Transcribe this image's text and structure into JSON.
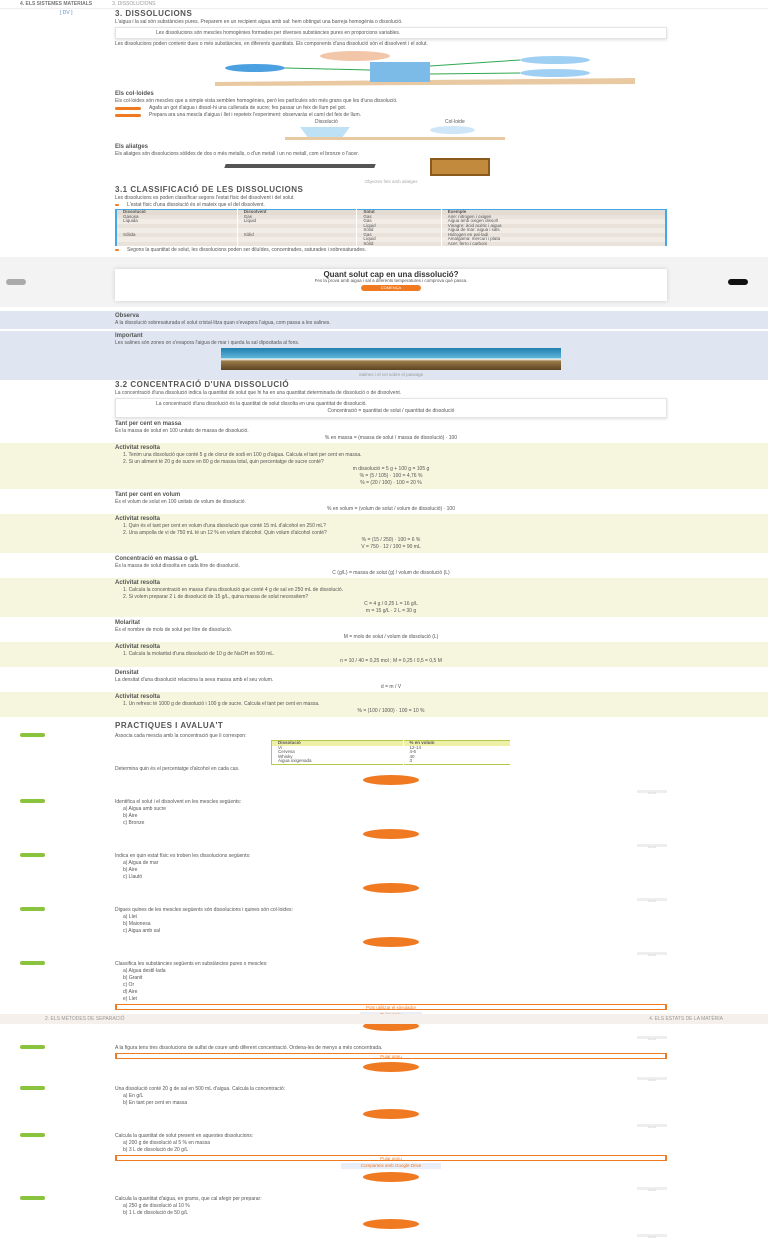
{
  "header": {
    "unit": "4. ELS SISTEMES MATERIALS",
    "section": "3. DISSOLUCIONS",
    "page_link": "[ DV ]"
  },
  "s3": {
    "title": "3. DISSOLUCIONS",
    "intro": "L'aigua i la sal són substàncies pures. Preparem en un recipient aigua amb sal: hem obtingut una barreja homogènia o dissolució.",
    "def": "Les dissolucions són mescles homogènies formades per diverses substàncies pures en proporcions variables.",
    "p2": "Les dissolucions poden contenir dues o més substàncies, en diferents quantitats. Els components d'una dissolució són el dissolvent i el solut.",
    "colloids_title": "Els col·loides",
    "colloids_text": "Els col·loides són mescles que a simple vista semblen homogènies, però les partícules són més grans que les d'una dissolució.",
    "notes": [
      "Agafa un got d'aigua i dissol-hi una cullerada de sucre; fes passar un feix de llum pel got.",
      "Prepara ara una mescla d'aigua i llet i repeteix l'experiment: observaràs el camí del feix de llum."
    ],
    "fig2_labels": [
      "Dissolució",
      "Col·loide"
    ],
    "alloys_title": "Els aliatges",
    "alloys_text": "Els aliatges són dissolucions sòlides de dos o més metalls, o d'un metall i un no metall, com el bronze o l'acer.",
    "caption": "Objectes fets amb aliatges"
  },
  "s31": {
    "title": "3.1 CLASSIFICACIÓ DE LES DISSOLUCIONS",
    "intro": "Les dissolucions es poden classificar segons l'estat físic del dissolvent i del solut.",
    "bullet": "L'estat físic d'una dissolució és el mateix que el del dissolvent.",
    "headers": [
      "Dissolució",
      "Dissolvent",
      "Solut",
      "Exemple"
    ],
    "rows": [
      [
        "Gasosa",
        "Gas",
        "Gas",
        "Aire: nitrogen i oxigen"
      ],
      [
        "Líquida",
        "Líquid",
        "Gas",
        "Aigua amb oxigen dissolt"
      ],
      [
        "",
        "",
        "Líquid",
        "Vinagre: àcid acètic i aigua"
      ],
      [
        "",
        "",
        "Sòlid",
        "Aigua de mar: aigua i sals"
      ],
      [
        "Sòlida",
        "Sòlid",
        "Gas",
        "Hidrogen en pal·ladi"
      ],
      [
        "",
        "",
        "Líquid",
        "Amalgama: mercuri i plata"
      ],
      [
        "",
        "",
        "Sòlid",
        "Acer: ferro i carboni"
      ]
    ],
    "bullet2": "Segons la quantitat de solut, les dissolucions poden ser diluïdes, concentrades, saturades i sobresaturades."
  },
  "card": {
    "title": "Quant solut cap en una dissolució?",
    "subtitle": "Fes la prova amb aigua i sal a diferents temperatures i comprova què passa.",
    "button": "COMENÇA"
  },
  "observa": {
    "title": "Observa",
    "text": "A la dissolució sobresaturada el solut cristal·litza quan s'evapora l'aigua, com passa a les salines."
  },
  "important": {
    "title": "Important",
    "text": "Les salines són zones on s'evapora l'aigua de mar i queda la sal dipositada al fons.",
    "caption": "Salines i el cel sobre el paisatge"
  },
  "s32": {
    "title": "3.2 CONCENTRACIÓ D'UNA DISSOLUCIÓ",
    "intro": "La concentració d'una dissolució indica la quantitat de solut que hi ha en una quantitat determinada de dissolució o de dissolvent.",
    "def": "La concentració d'una dissolució és la quantitat de solut dissolta en una quantitat de dissolució.",
    "formula": "Concentració = quantitat de solut / quantitat de dissolució"
  },
  "sections": [
    {
      "title": "Tant per cent en massa",
      "text": "És la massa de solut en 100 unitats de massa de dissolució.",
      "formula": "% en massa = (massa de solut / massa de dissolució) · 100",
      "act": "Activitat resolta",
      "items": [
        "Tenim una dissolució que conté 5 g de clorur de sodi en 100 g d'aigua. Calcula el tant per cent en massa.",
        "Si un aliment té 20 g de sucre en 80 g de massa total, quin percentatge de sucre conté?"
      ],
      "lines": [
        "m dissolució = 5 g + 100 g = 105 g",
        "% = (5 / 105) · 100 = 4,76 %",
        "% = (20 / 100) · 100 = 20 %"
      ]
    },
    {
      "title": "Tant per cent en volum",
      "text": "És el volum de solut en 100 unitats de volum de dissolució.",
      "formula": "% en volum = (volum de solut / volum de dissolució) · 100",
      "act": "Activitat resolta",
      "items": [
        "Quin és el tant per cent en volum d'una dissolució que conté 15 mL d'alcohol en 250 mL?",
        "Una ampolla de vi de 750 mL té un 12 % en volum d'alcohol. Quin volum d'alcohol conté?"
      ],
      "lines": [
        "% = (15 / 250) · 100 = 6 %",
        "V = 750 · 12 / 100 = 90 mL"
      ]
    },
    {
      "title": "Concentració en massa o g/L",
      "text": "És la massa de solut dissolta en cada litre de dissolució.",
      "formula": "C (g/L) = massa de solut (g) / volum de dissolució (L)",
      "act": "Activitat resolta",
      "items": [
        "Calcula la concentració en massa d'una dissolució que conté 4 g de sal en 250 mL de dissolució.",
        "Si volem preparar 2 L de dissolució de 15 g/L, quina massa de solut necessitem?"
      ],
      "lines": [
        "C = 4 g / 0,25 L = 16 g/L",
        "m = 15 g/L · 2 L = 30 g"
      ]
    },
    {
      "title": "Molaritat",
      "text": "És el nombre de mols de solut per litre de dissolució.",
      "formula": "M = mols de solut / volum de dissolució (L)",
      "act": "Activitat resolta",
      "items": [
        "Calcula la molaritat d'una dissolució de 10 g de NaOH en 500 mL."
      ],
      "lines": [
        "n = 10 / 40 = 0,25 mol ; M = 0,25 / 0,5 = 0,5 M"
      ]
    },
    {
      "title": "Densitat",
      "text": "La densitat d'una dissolució relaciona la seva massa amb el seu volum.",
      "formula": "d = m / V",
      "act": "Activitat resolta",
      "items": [
        "Un refresc té 1000 g de dissolució i 100 g de sucre. Calcula el tant per cent en massa."
      ],
      "lines": [
        "% = (100 / 1000) · 100 = 10 %"
      ]
    }
  ],
  "practice": {
    "title": "PRACTIQUES I AVALUA'T",
    "exercises": [
      {
        "num": "1",
        "text": "Associa cada mescla amb la concentració que li correspon:",
        "table": {
          "headers": [
            "Dissolució",
            "% en volum"
          ],
          "rows": [
            [
              "Vi",
              "12-14"
            ],
            [
              "Cervesa",
              "4-6"
            ],
            [
              "Whisky",
              "40"
            ],
            [
              "Aigua oxigenada",
              "3"
            ]
          ]
        },
        "after": "Determina quin és el percentatge d'alcohol en cada cas."
      },
      {
        "num": "2",
        "text": "Identifica el solut i el dissolvent en les mescles següents:",
        "items": [
          "a) Aigua amb sucre",
          "b) Aire",
          "c) Bronze"
        ]
      },
      {
        "num": "3",
        "text": "Indica en quin estat físic es troben les dissolucions següents:",
        "items": [
          "a) Aigua de mar",
          "b) Aire",
          "c) Llautó"
        ]
      },
      {
        "num": "4",
        "text": "Digues quines de les mescles següents són dissolucions i quines són col·loides:",
        "items": [
          "a) Llet",
          "b) Maionesa",
          "c) Aigua amb sal"
        ]
      },
      {
        "num": "5",
        "text": "Classifica les substàncies següents en substàncies pures o mescles:",
        "items": [
          "a) Aigua destil·lada",
          "b) Granit",
          "c) Or",
          "d) Aire",
          "e) Llet"
        ],
        "tool": "Pots utilitzar el simulador",
        "button": "Pujar arxiu"
      },
      {
        "num": "6",
        "text": "A la figura tens tres dissolucions de sulfat de coure amb diferent concentració. Ordena-les de menys a més concentrada.",
        "tool": "Pujar arxiu"
      },
      {
        "num": "7",
        "text": "Una dissolució conté 20 g de sal en 500 mL d'aigua. Calcula la concentració:",
        "items": [
          "a) En g/L",
          "b) En tant per cent en massa"
        ]
      },
      {
        "num": "8",
        "text": "Calcula la quantitat de solut present en aquestes dissolucions:",
        "items": [
          "a) 200 g de dissolució al 5 % en massa",
          "b) 3 L de dissolució de 20 g/L"
        ],
        "tool": "Pujar arxiu",
        "tool2": "Comparteix amb Google Drive"
      },
      {
        "num": "9",
        "text": "Calcula la quantitat d'aigua, en grams, que cal afegir per preparar:",
        "items": [
          "a) 250 g de dissolució al 10 %",
          "b) 1 L de dissolució de 50 g/L"
        ]
      }
    ],
    "submit": "Envia"
  },
  "footer": {
    "prev": "2. ELS MÈTODES DE SEPARACIÓ",
    "next": "4. ELS ESTATS DE LA MATÈRIA"
  }
}
